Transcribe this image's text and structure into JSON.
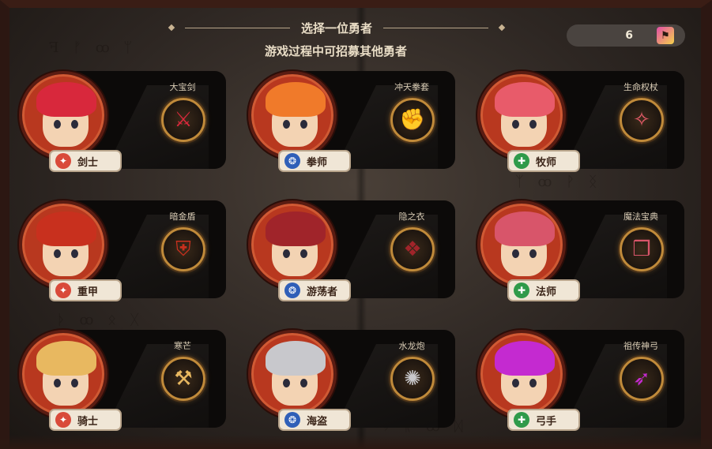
{
  "header": {
    "title": "选择一位勇者",
    "subtitle": "游戏过程中可招募其他勇者"
  },
  "counter": {
    "value": "6",
    "icon": "hero-token-icon"
  },
  "heroes": [
    {
      "name": "剑士",
      "weapon": "大宝剑",
      "class": "warrior",
      "class_color": "#d94a3a",
      "class_symbol": "✦",
      "hair_color": "#d8283c",
      "weapon_symbol": "⚔"
    },
    {
      "name": "拳师",
      "weapon": "冲天拳套",
      "class": "rogue",
      "class_color": "#2f5fb8",
      "class_symbol": "❂",
      "hair_color": "#f07a2a",
      "weapon_symbol": "✊"
    },
    {
      "name": "牧师",
      "weapon": "生命权杖",
      "class": "support",
      "class_color": "#2f9a4a",
      "class_symbol": "✚",
      "hair_color": "#e85b6a",
      "weapon_symbol": "✧"
    },
    {
      "name": "重甲",
      "weapon": "暗金盾",
      "class": "warrior",
      "class_color": "#d94a3a",
      "class_symbol": "✦",
      "hair_color": "#c8301e",
      "weapon_symbol": "⛨"
    },
    {
      "name": "游荡者",
      "weapon": "隐之衣",
      "class": "rogue",
      "class_color": "#2f5fb8",
      "class_symbol": "❂",
      "hair_color": "#a0242a",
      "weapon_symbol": "❖"
    },
    {
      "name": "法师",
      "weapon": "魔法宝典",
      "class": "support",
      "class_color": "#2f9a4a",
      "class_symbol": "✚",
      "hair_color": "#d8556a",
      "weapon_symbol": "❒"
    },
    {
      "name": "骑士",
      "weapon": "寒芒",
      "class": "warrior",
      "class_color": "#d94a3a",
      "class_symbol": "✦",
      "hair_color": "#e8b860",
      "weapon_symbol": "⚒"
    },
    {
      "name": "海盗",
      "weapon": "水龙炮",
      "class": "rogue",
      "class_color": "#2f5fb8",
      "class_symbol": "❂",
      "hair_color": "#c8c8cc",
      "weapon_symbol": "✺"
    },
    {
      "name": "弓手",
      "weapon": "祖传神弓",
      "class": "support",
      "class_color": "#2f9a4a",
      "class_symbol": "✚",
      "hair_color": "#c42ad0",
      "weapon_symbol": "➶"
    }
  ]
}
